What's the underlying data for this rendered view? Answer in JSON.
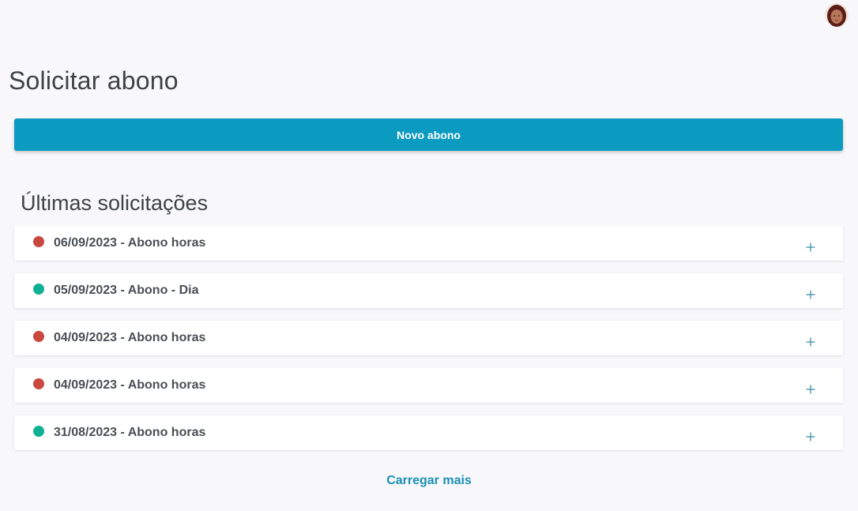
{
  "header": {
    "avatar_icon": "user-avatar"
  },
  "page": {
    "title": "Solicitar abono",
    "new_button_label": "Novo abono"
  },
  "requests": {
    "section_title": "Últimas solicitações",
    "items": [
      {
        "label": "06/09/2023 - Abono horas",
        "status": "red"
      },
      {
        "label": "05/09/2023 - Abono - Dia",
        "status": "green"
      },
      {
        "label": "04/09/2023 - Abono horas",
        "status": "red"
      },
      {
        "label": "04/09/2023 - Abono horas",
        "status": "red"
      },
      {
        "label": "31/08/2023 - Abono horas",
        "status": "green"
      }
    ],
    "load_more_label": "Carregar mais"
  },
  "colors": {
    "accent": "#0b9ac0",
    "status_red": "#c9483f",
    "status_green": "#10b094",
    "link": "#1a8fb4",
    "background": "#f8f8fa"
  }
}
